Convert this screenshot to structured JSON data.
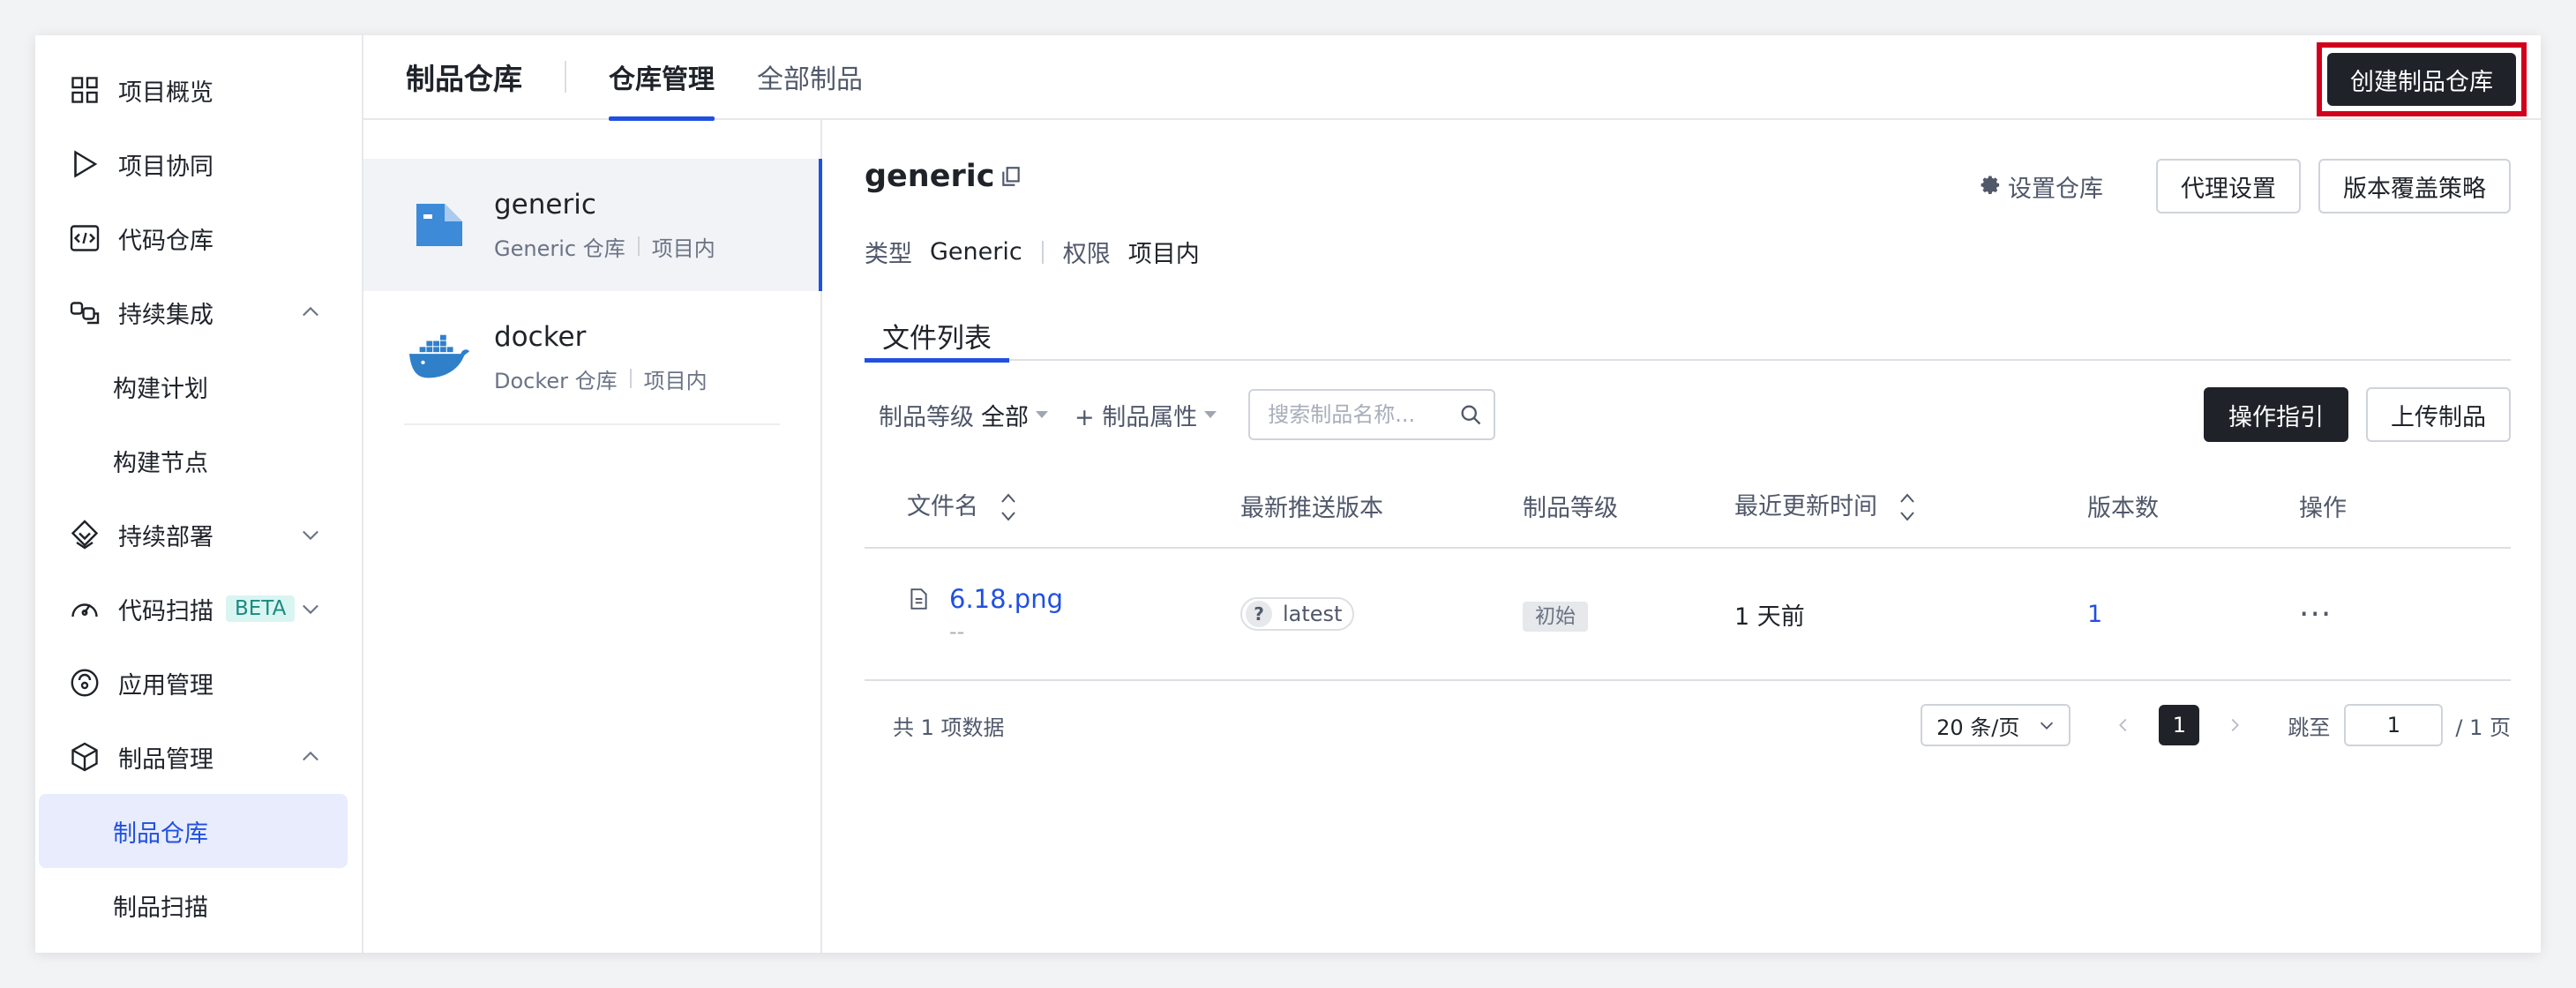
{
  "sidebar": {
    "items": [
      {
        "label": "项目概览",
        "icon": "grid-icon"
      },
      {
        "label": "项目协同",
        "icon": "play-icon"
      },
      {
        "label": "代码仓库",
        "icon": "code-icon"
      },
      {
        "label": "持续集成",
        "icon": "ci-icon",
        "expanded": true
      },
      {
        "label": "构建计划"
      },
      {
        "label": "构建节点"
      },
      {
        "label": "持续部署",
        "icon": "deploy-icon",
        "expanded": false
      },
      {
        "label": "代码扫描",
        "icon": "gauge-icon",
        "badge": "BETA",
        "expanded": false
      },
      {
        "label": "应用管理",
        "icon": "app-icon"
      },
      {
        "label": "制品管理",
        "icon": "box-icon",
        "expanded": true
      },
      {
        "label": "制品仓库",
        "active": true
      },
      {
        "label": "制品扫描"
      }
    ]
  },
  "header": {
    "title": "制品仓库",
    "tabs": [
      {
        "label": "仓库管理",
        "active": true
      },
      {
        "label": "全部制品"
      }
    ],
    "create_button": "创建制品仓库"
  },
  "repos": [
    {
      "name": "generic",
      "type": "Generic 仓库",
      "scope": "项目内",
      "icon": "folder-icon",
      "active": true
    },
    {
      "name": "docker",
      "type": "Docker 仓库",
      "scope": "项目内",
      "icon": "docker-whale-icon"
    }
  ],
  "detail": {
    "title": "generic",
    "settings_link": "设置仓库",
    "proxy_button": "代理设置",
    "overwrite_button": "版本覆盖策略",
    "type_label": "类型",
    "type_value": "Generic",
    "perm_label": "权限",
    "perm_value": "项目内",
    "subtab": "文件列表",
    "filters": {
      "level_label": "制品等级",
      "level_value": "全部",
      "attr_label": "+ 制品属性",
      "search_placeholder": "搜索制品名称..."
    },
    "guide_button": "操作指引",
    "upload_button": "上传制品",
    "table": {
      "columns": [
        "文件名",
        "最新推送版本",
        "制品等级",
        "最近更新时间",
        "版本数",
        "操作"
      ],
      "rows": [
        {
          "name": "6.18.png",
          "sub": "--",
          "version": "latest",
          "level": "初始",
          "updated": "1 天前",
          "count": "1",
          "action": "···"
        }
      ]
    },
    "footer": {
      "total": "共 1 项数据",
      "page_size": "20 条/页",
      "current_page": "1",
      "jump_label": "跳至",
      "jump_value": "1",
      "total_pages": "/ 1 页"
    }
  },
  "colors": {
    "accent": "#2050e0",
    "dark": "#1f2329",
    "highlight_border": "#d0021b"
  }
}
